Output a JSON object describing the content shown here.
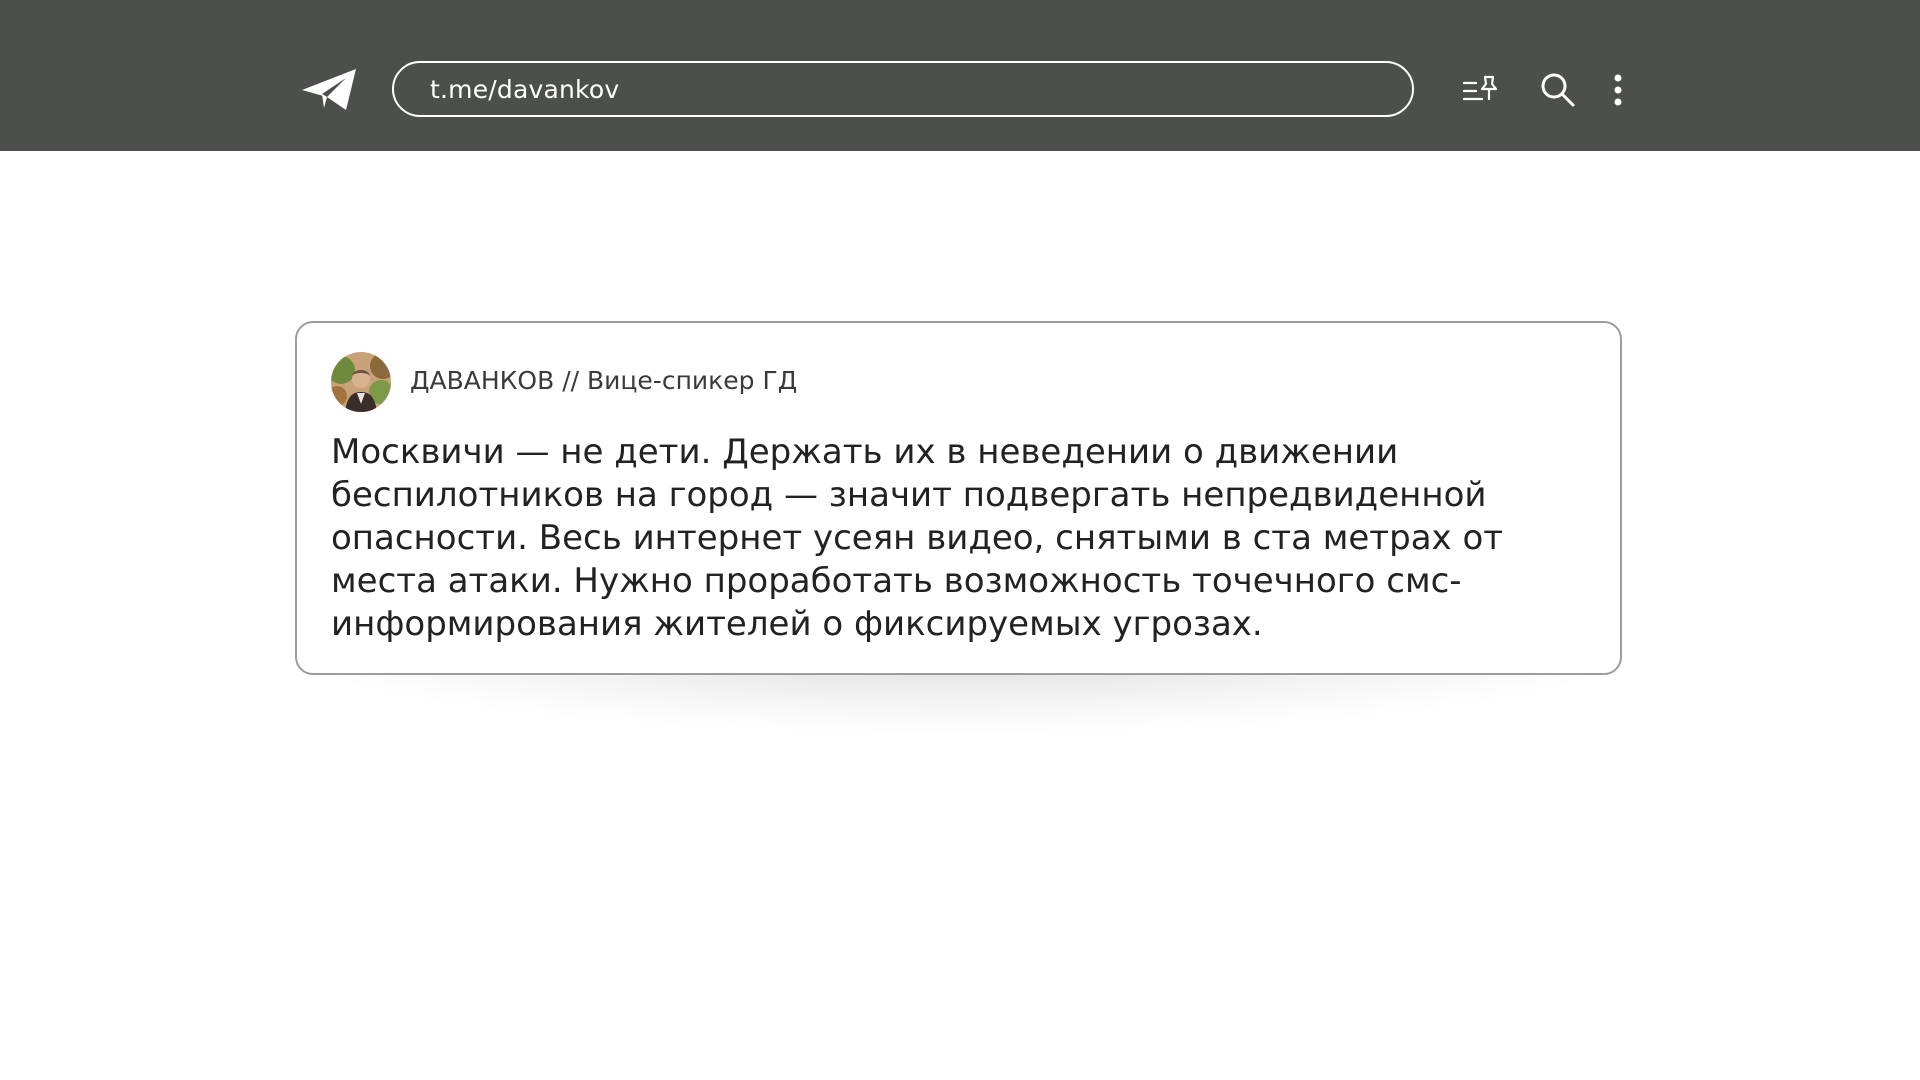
{
  "header": {
    "url": "t.me/davankov",
    "icons": {
      "logo": "telegram-logo-icon",
      "pinned_list": "pinned-list-icon",
      "search": "search-icon",
      "menu": "kebab-menu-icon"
    }
  },
  "post": {
    "channel_name": "ДАВАНКОВ // Вице-спикер ГД",
    "text": "Москвичи — не дети. Держать их в неведении о движении беспилотников на город — значит подвергать непредвиденной опасности. Весь интернет усеян видео, снятыми в ста метрах от места атаки. Нужно проработать возможность точечного смс-информирования жителей о фиксируемых угрозах."
  },
  "colors": {
    "topbar": "#4b504a",
    "card_border": "#9c9c9c",
    "text": "#222222"
  }
}
